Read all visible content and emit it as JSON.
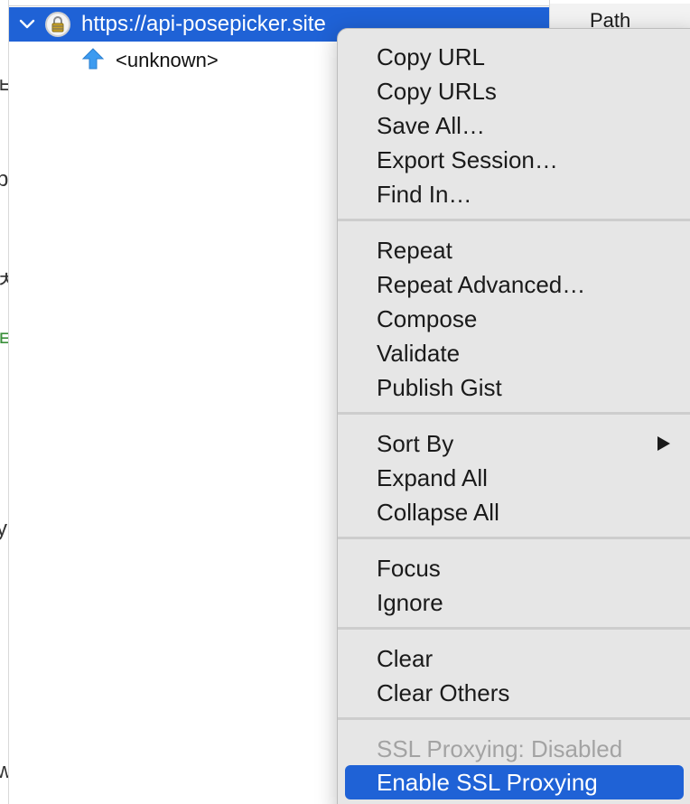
{
  "tree": {
    "selected_host": "https://api-posepicker.site",
    "child_label": "<unknown>"
  },
  "right_column": {
    "header": "Path"
  },
  "gutter": {
    "glyphs": [
      "ㅂ",
      "p",
      "ㅊ",
      "ㅌ",
      "y",
      "l",
      "w"
    ]
  },
  "context_menu": {
    "groups": [
      {
        "items": [
          "Copy URL",
          "Copy URLs",
          "Save All…",
          "Export Session…",
          "Find In…"
        ]
      },
      {
        "items": [
          "Repeat",
          "Repeat Advanced…",
          "Compose",
          "Validate",
          "Publish Gist"
        ]
      },
      {
        "items": [
          "Sort By",
          "Expand All",
          "Collapse All"
        ]
      },
      {
        "items": [
          "Focus",
          "Ignore"
        ]
      },
      {
        "items": [
          "Clear",
          "Clear Others"
        ]
      },
      {
        "items": [
          "SSL Proxying: Disabled",
          "Enable SSL Proxying"
        ]
      }
    ],
    "disabled_item": "SSL Proxying: Disabled",
    "highlighted_item": "Enable SSL Proxying",
    "submenu_item": "Sort By"
  },
  "colors": {
    "selection": "#1f62d6",
    "menu_background": "#e6e6e6",
    "disabled_text": "#a3a3a3"
  }
}
